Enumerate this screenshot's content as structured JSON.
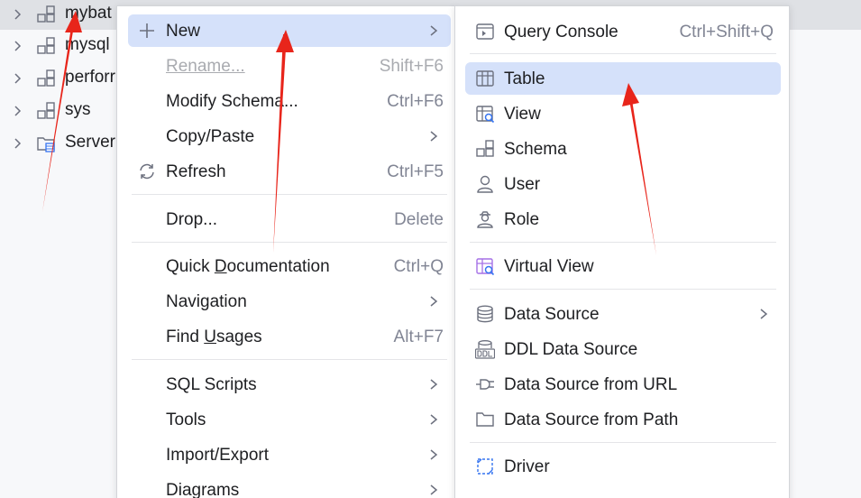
{
  "tree": {
    "items": [
      {
        "label": "mybat"
      },
      {
        "label": "mysql"
      },
      {
        "label": "perforr"
      },
      {
        "label": "sys"
      },
      {
        "label": "Server"
      }
    ]
  },
  "context_menu": {
    "new": {
      "label": "New"
    },
    "rename": {
      "label": "Rename...",
      "shortcut": "Shift+F6"
    },
    "modify_schema": {
      "label": "Modify Schema...",
      "shortcut": "Ctrl+F6"
    },
    "copy_paste": {
      "label": "Copy/Paste"
    },
    "refresh": {
      "label": "Refresh",
      "shortcut": "Ctrl+F5"
    },
    "drop": {
      "label": "Drop...",
      "shortcut": "Delete"
    },
    "quick_doc": {
      "label_pre": "Quick ",
      "label_u": "D",
      "label_post": "ocumentation",
      "shortcut": "Ctrl+Q"
    },
    "navigation": {
      "label": "Navigation"
    },
    "find_usages": {
      "label_pre": "Find ",
      "label_u": "U",
      "label_post": "sages",
      "shortcut": "Alt+F7"
    },
    "sql_scripts": {
      "label": "SQL Scripts"
    },
    "tools": {
      "label": "Tools"
    },
    "import_export": {
      "label": "Import/Export"
    },
    "diagrams": {
      "label": "Diagrams"
    }
  },
  "new_submenu": {
    "query_console": {
      "label": "Query Console",
      "shortcut": "Ctrl+Shift+Q"
    },
    "table": {
      "label": "Table"
    },
    "view": {
      "label": "View"
    },
    "schema": {
      "label": "Schema"
    },
    "user": {
      "label": "User"
    },
    "role": {
      "label": "Role"
    },
    "virtual_view": {
      "label": "Virtual View"
    },
    "data_source": {
      "label": "Data Source"
    },
    "ddl_data_source": {
      "label": "DDL Data Source"
    },
    "data_source_url": {
      "label": "Data Source from URL"
    },
    "data_source_path": {
      "label": "Data Source from Path"
    },
    "driver": {
      "label": "Driver"
    }
  },
  "colors": {
    "selection": "#d5e1fa",
    "tree_selection": "#dfe1e5",
    "annotation_arrow": "#e8251b",
    "shortcut_text": "#818594",
    "disabled_text": "#a9abb0"
  }
}
